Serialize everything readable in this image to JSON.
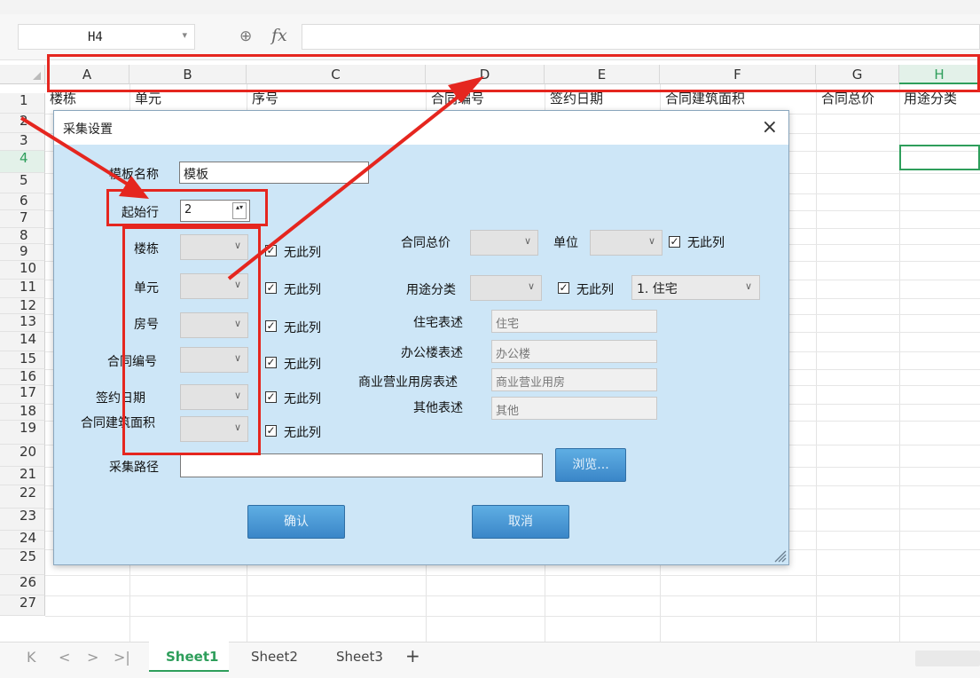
{
  "formula_bar": {
    "cell_ref": "H4",
    "dropdown_glyph": "▾",
    "zoom_icon": "⊕",
    "fx_label": "fx"
  },
  "columns": [
    "A",
    "B",
    "C",
    "D",
    "E",
    "F",
    "G",
    "H"
  ],
  "rows": [
    "1",
    "2",
    "3",
    "4",
    "5",
    "6",
    "7",
    "8",
    "9",
    "10",
    "11",
    "12",
    "13",
    "14",
    "15",
    "16",
    "17",
    "18",
    "19",
    "20",
    "21",
    "22",
    "23",
    "24",
    "25",
    "26",
    "27"
  ],
  "header_row": {
    "A": "楼栋",
    "B": "单元",
    "C": "序号",
    "D": "合同编号",
    "E": "签约日期",
    "F": "合同建筑面积",
    "G": "合同总价",
    "H": "用途分类"
  },
  "sheet_tabs": [
    "Sheet1",
    "Sheet2",
    "Sheet3"
  ],
  "tab_nav": {
    "first": "K",
    "prev": "<",
    "next": ">",
    "last": ">|",
    "add": "+"
  },
  "dialog": {
    "title": "采集设置",
    "close_glyph": "×",
    "template_name_label": "模板名称",
    "template_name_value": "模板",
    "start_row_label": "起始行",
    "start_row_value": "2",
    "spin_glyph": "▴▾",
    "no_column_label": "无此列",
    "checkmark": "✓",
    "combo_arrow": "∨",
    "left_fields": [
      "楼栋",
      "单元",
      "房号",
      "合同编号",
      "签约日期",
      "合同建筑面积"
    ],
    "total_price_label": "合同总价",
    "unit_label": "单位",
    "usage_label": "用途分类",
    "usage_value": "1. 住宅",
    "descriptions": [
      {
        "label": "住宅表述",
        "value": "住宅"
      },
      {
        "label": "办公楼表述",
        "value": "办公楼"
      },
      {
        "label": "商业营业用房表述",
        "value": "商业营业用房"
      },
      {
        "label": "其他表述",
        "value": "其他"
      }
    ],
    "collect_path_label": "采集路径",
    "browse_button": "浏览...",
    "ok_button": "确认",
    "cancel_button": "取消"
  },
  "colors": {
    "accent_green": "#2e9e5b",
    "annotation_red": "#e5261f",
    "dialog_bg": "#cde6f7",
    "button_blue": "#3a86c8"
  }
}
